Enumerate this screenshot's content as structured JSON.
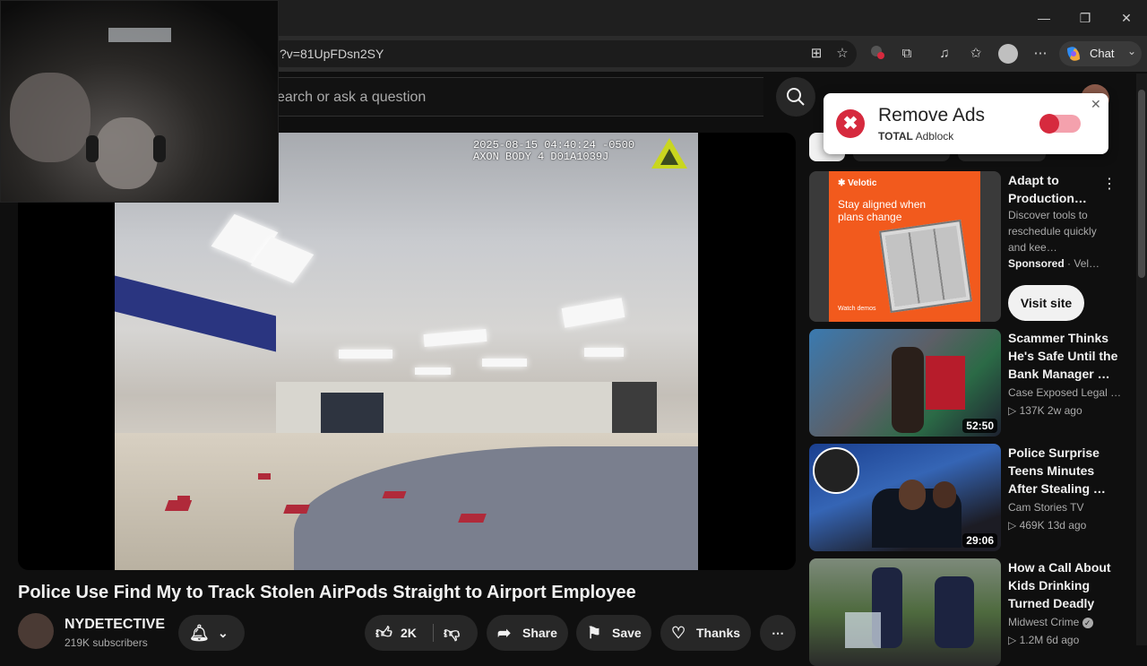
{
  "browser": {
    "url": "?v=81UpFDsn2SY",
    "chat_label": "Chat",
    "window_controls": [
      "minimize-icon",
      "restore-icon",
      "close-icon"
    ]
  },
  "youtube": {
    "search_placeholder": "earch or ask a question"
  },
  "video": {
    "timestamp_line1": "2025-08-15 04:40:24 -0500",
    "timestamp_line2": "AXON BODY 4 D01A1039J",
    "title": "Police Use Find My to Track Stolen AirPods Straight to Airport Employee",
    "channel": "NYDETECTIVE",
    "subscribers": "219K subscribers",
    "likes": "2K",
    "share_label": "Share",
    "save_label": "Save",
    "thanks_label": "Thanks"
  },
  "ad_popup": {
    "title": "Remove Ads",
    "brand_bold": "TOTAL",
    "brand_rest": " Adblock"
  },
  "sidebar": {
    "ad": {
      "title": "Adapt to Production…",
      "description": "Discover tools to reschedule quickly and kee…",
      "sponsored": "Sponsored",
      "advertiser": "· Vel…",
      "cta": "Visit site",
      "thumb_brand": "✱ Velotic",
      "thumb_headline": "Stay aligned when plans change",
      "thumb_footer": "Watch demos"
    },
    "items": [
      {
        "title": "Scammer Thinks He's Safe Until the Bank Manager …",
        "channel": "Case Exposed Legal …",
        "stats": "137K  2w ago",
        "duration": "52:50"
      },
      {
        "title": "Police Surprise Teens Minutes After Stealing …",
        "channel": "Cam Stories TV",
        "stats": "469K  13d ago",
        "duration": "29:06"
      },
      {
        "title": "How a Call About Kids Drinking Turned Deadly",
        "channel": "Midwest Crime",
        "stats": "1.2M  6d ago",
        "duration": ""
      }
    ]
  },
  "colors": {
    "background": "#0f0f0f",
    "adblock_red": "#d62a3e",
    "ad_orange": "#f25a1d"
  }
}
